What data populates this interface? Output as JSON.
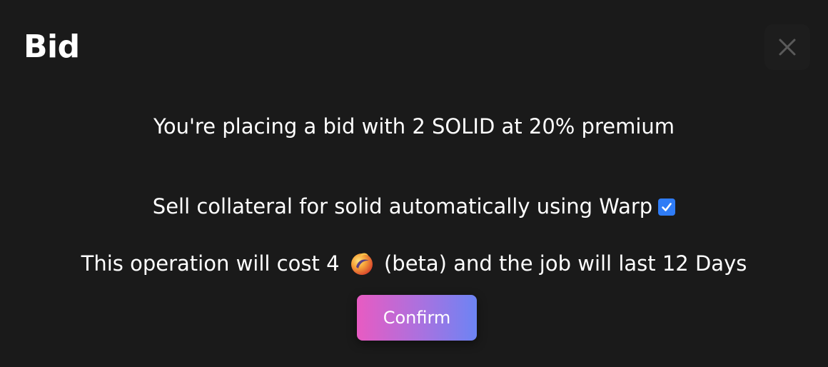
{
  "modal": {
    "title": "Bid",
    "close_icon": "close-icon",
    "bid_text": "You're placing a bid with 2 SOLID at 20% premium",
    "warp_option": {
      "label": "Sell collateral for solid automatically using Warp",
      "checked": true
    },
    "cost_line": {
      "prefix": "This operation will cost 4",
      "token_icon": "terra-luna-token-icon",
      "suffix": "(beta) and the job will last 12 Days"
    },
    "confirm_label": "Confirm"
  },
  "colors": {
    "background": "#1a1a1a",
    "checkbox": "#2f7cf6",
    "button_gradient_start": "#e85bc2",
    "button_gradient_end": "#6c84f4"
  }
}
